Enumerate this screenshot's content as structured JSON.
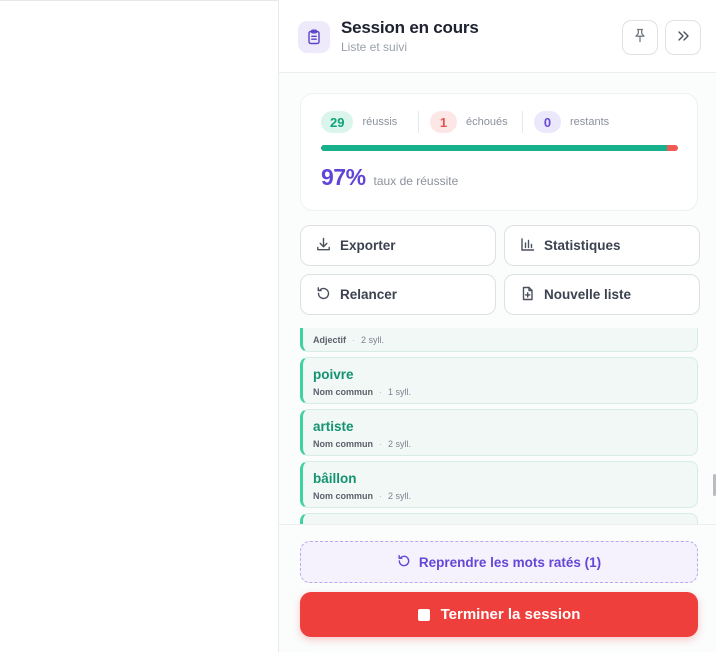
{
  "header": {
    "title": "Session en cours",
    "subtitle": "Liste et suivi",
    "icon": "clipboard-icon",
    "pin_icon": "pin-icon",
    "collapse_icon": "double-chevron-right-icon"
  },
  "stats": {
    "success_count": "29",
    "success_label": "réussis",
    "failed_count": "1",
    "failed_label": "échoués",
    "remaining_count": "0",
    "remaining_label": "restants",
    "progress_fraction": 0.97,
    "rate_value": "97%",
    "rate_label": "taux de réussite"
  },
  "actions": {
    "export_label": "Exporter",
    "stats_label": "Statistiques",
    "restart_label": "Relancer",
    "new_list_label": "Nouvelle liste"
  },
  "words": [
    {
      "word": "",
      "type": "Adjectif",
      "syllables": "2 syll."
    },
    {
      "word": "poivre",
      "type": "Nom commun",
      "syllables": "1 syll."
    },
    {
      "word": "artiste",
      "type": "Nom commun",
      "syllables": "2 syll."
    },
    {
      "word": "bâillon",
      "type": "Nom commun",
      "syllables": "2 syll."
    }
  ],
  "footer": {
    "retry_label": "Reprendre les mots ratés (1)",
    "finish_label": "Terminer la session"
  },
  "colors": {
    "accent": "#6145d8",
    "success": "#16b08a",
    "danger": "#ef3f3c"
  }
}
